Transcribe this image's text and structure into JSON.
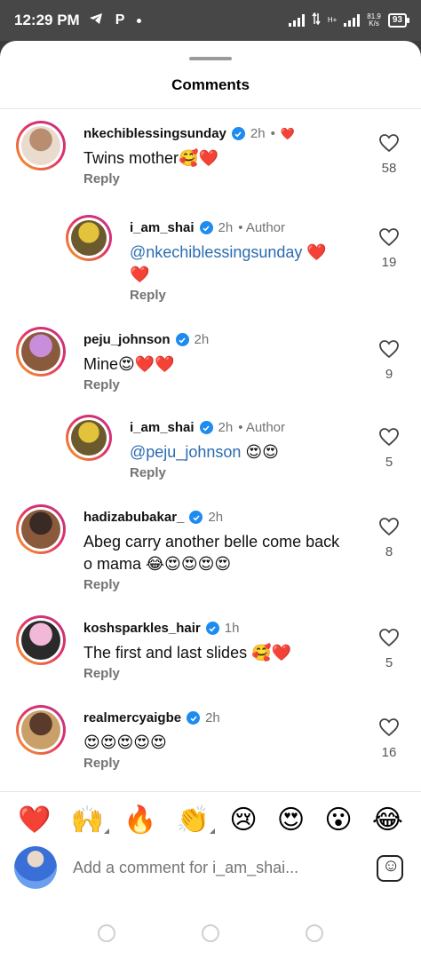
{
  "status_bar": {
    "time": "12:29 PM",
    "left_icons": [
      "telegram-icon",
      "p-icon",
      "dot-icon"
    ],
    "p_glyph": "P",
    "network_type": "H+",
    "speed_value": "81.9",
    "speed_unit": "K/s",
    "battery": "93"
  },
  "sheet": {
    "title": "Comments"
  },
  "comments": [
    {
      "username": "nkechiblessingsunday",
      "verified": true,
      "time": "2h",
      "extra": "•",
      "extra_emoji": "❤️",
      "text": "Twins mother🥰❤️",
      "mention": "",
      "reply_label": "Reply",
      "likes": "58",
      "avatar_colors": [
        "#b98d6f",
        "#e9dccf"
      ]
    },
    {
      "username": "i_am_shai",
      "verified": true,
      "time": "2h",
      "extra": "• Author",
      "extra_emoji": "",
      "text": " ❤️ ❤️",
      "mention": "@nkechiblessingsunday",
      "reply_label": "Reply",
      "likes": "19",
      "avatar_colors": [
        "#e3c33b",
        "#6b5a2d"
      ]
    },
    {
      "username": "peju_johnson",
      "verified": true,
      "time": "2h",
      "extra": "",
      "extra_emoji": "",
      "text": "Mine😍❤️❤️",
      "mention": "",
      "reply_label": "Reply",
      "likes": "9",
      "avatar_colors": [
        "#c98edb",
        "#8a5a3c"
      ]
    },
    {
      "username": "i_am_shai",
      "verified": true,
      "time": "2h",
      "extra": "• Author",
      "extra_emoji": "",
      "text": " 😍😍",
      "mention": "@peju_johnson",
      "reply_label": "Reply",
      "likes": "5",
      "avatar_colors": [
        "#e3c33b",
        "#6b5a2d"
      ]
    },
    {
      "username": "hadizabubakar_",
      "verified": true,
      "time": "2h",
      "extra": "",
      "extra_emoji": "",
      "text": "Abeg carry another belle come back o mama 😂😍😍😍😍",
      "mention": "",
      "reply_label": "Reply",
      "likes": "8",
      "avatar_colors": [
        "#3a2a24",
        "#8a5a3c"
      ]
    },
    {
      "username": "koshsparkles_hair",
      "verified": true,
      "time": "1h",
      "extra": "",
      "extra_emoji": "",
      "text": "The first and last slides 🥰❤️",
      "mention": "",
      "reply_label": "Reply",
      "likes": "5",
      "avatar_colors": [
        "#f2b8d8",
        "#2a2a2a"
      ]
    },
    {
      "username": "realmercyaigbe",
      "verified": true,
      "time": "2h",
      "extra": "",
      "extra_emoji": "",
      "text": "😍😍😍😍😍",
      "mention": "",
      "reply_label": "Reply",
      "likes": "16",
      "avatar_colors": [
        "#5a3a2a",
        "#c9a06a"
      ]
    }
  ],
  "emoji_bar": [
    "❤️",
    "🙌",
    "🔥",
    "👏",
    "😢",
    "😍",
    "😮",
    "😂"
  ],
  "composer": {
    "placeholder": "Add a comment for i_am_shai..."
  }
}
